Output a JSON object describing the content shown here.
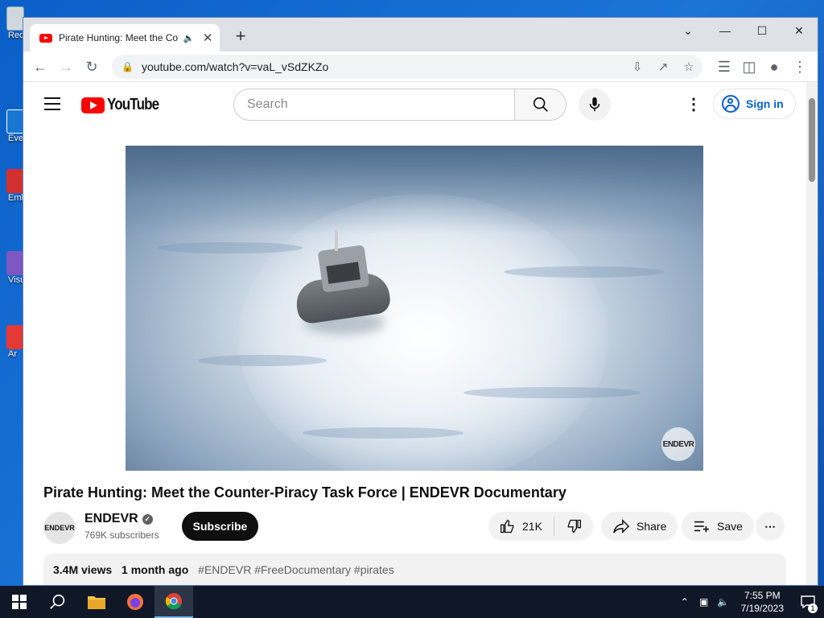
{
  "desktop": {
    "icons": [
      {
        "label": "Rec"
      },
      {
        "label": "Eve"
      },
      {
        "label": "Emb"
      },
      {
        "label": "Visu"
      },
      {
        "label": "Ar"
      }
    ]
  },
  "browser": {
    "tab": {
      "title": "Pirate Hunting: Meet the Cou",
      "audio_icon": "speaker-icon"
    },
    "url": "youtube.com/watch?v=vaL_vSdZKZo",
    "window_controls": [
      "chevron-down",
      "minimize",
      "maximize",
      "close"
    ]
  },
  "youtube": {
    "logo_text": "YouTube",
    "search_placeholder": "Search",
    "sign_in": "Sign in",
    "video": {
      "title": "Pirate Hunting: Meet the Counter-Piracy Task Force | ENDEVR Documentary",
      "watermark": "ENDEVR",
      "channel_name": "ENDEVR",
      "channel_avatar_text": "ENDEVR",
      "subscribers": "769K subscribers",
      "subscribe_label": "Subscribe",
      "likes": "21K",
      "share_label": "Share",
      "save_label": "Save",
      "views": "3.4M views",
      "posted": "1 month ago",
      "hashtags": "#ENDEVR #FreeDocumentary #pirates"
    }
  },
  "taskbar": {
    "time": "7:55 PM",
    "date": "7/19/2023",
    "notification_count": "1"
  },
  "colors": {
    "yt_red": "#ff0000",
    "link_blue": "#065fd4",
    "taskbar": "#101827",
    "desktop": "#1565c0"
  }
}
